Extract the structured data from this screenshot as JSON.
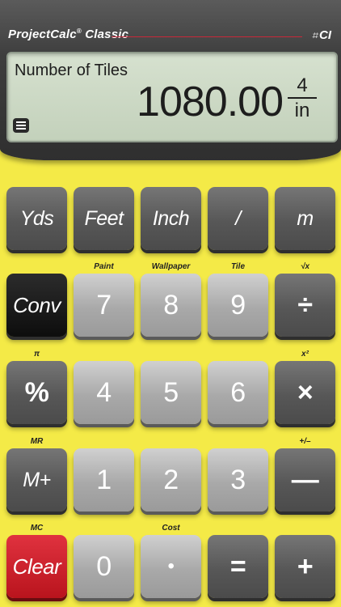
{
  "app": {
    "brand": "ProjectCalc",
    "brand_sup": "®",
    "model": "Classic",
    "logo_mark": "⌗",
    "logo_text": "CI"
  },
  "display": {
    "label": "Number of Tiles",
    "value": "1080.00",
    "fraction_num": "4",
    "fraction_den": "in"
  },
  "keys": {
    "yds": "Yds",
    "feet": "Feet",
    "inch": "Inch",
    "slash": "/",
    "meter": "m",
    "conv": "Conv",
    "seven": "7",
    "eight": "8",
    "nine": "9",
    "divide": "÷",
    "percent": "%",
    "four": "4",
    "five": "5",
    "six": "6",
    "multiply": "×",
    "mplus": "M+",
    "one": "1",
    "two": "2",
    "three": "3",
    "minus": "—",
    "clear": "Clear",
    "zero": "0",
    "dot": "•",
    "equals": "=",
    "plus": "+"
  },
  "sublabels": {
    "paint": "Paint",
    "wallpaper": "Wallpaper",
    "tile": "Tile",
    "sqrt": "√x",
    "pi": "π",
    "xsquared": "x²",
    "mr": "MR",
    "plusminus": "+/–",
    "mc": "MC",
    "cost": "Cost"
  },
  "colors": {
    "body": "#f4ea47",
    "clear_key": "#cf1f2a",
    "conv_key": "#111111",
    "display_bg": "#cdd9c5"
  }
}
